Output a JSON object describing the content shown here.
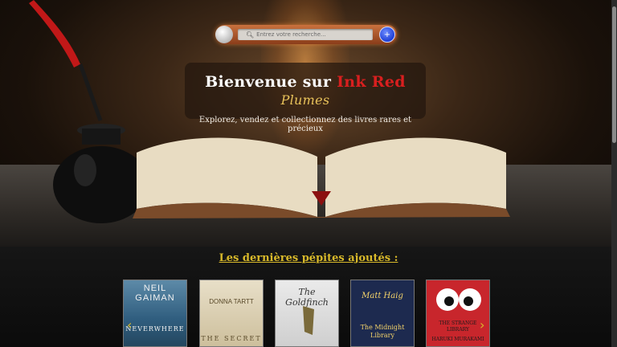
{
  "search": {
    "placeholder": "Entrez votre recherche...",
    "add_label": "+"
  },
  "hero": {
    "welcome_prefix": "Bienvenue sur",
    "brand_ink": "Ink Red",
    "brand_plumes": "Plumes",
    "tagline": "Explorez, vendez et collectionnez des livres rares et précieux"
  },
  "latest": {
    "title": "Les dernières pépites ajoutés :",
    "books": [
      {
        "author": "NEIL GAIMAN",
        "title": "NEVERWHERE"
      },
      {
        "author": "DONNA TARTT",
        "title": "THE SECRET"
      },
      {
        "author": "",
        "title": "The Goldfinch"
      },
      {
        "author": "Matt Haig",
        "title": "The Midnight Library"
      },
      {
        "author": "HARUKI MURAKAMI",
        "title": "THE STRANGE LIBRARY"
      }
    ]
  },
  "colors": {
    "accent_gold": "#d8b92a",
    "brand_red": "#d91f1f",
    "search_button_blue": "#1f3fd6"
  },
  "icons": {
    "search": "magnifier-icon",
    "prev": "chevron-left-icon",
    "next": "chevron-right-icon"
  }
}
